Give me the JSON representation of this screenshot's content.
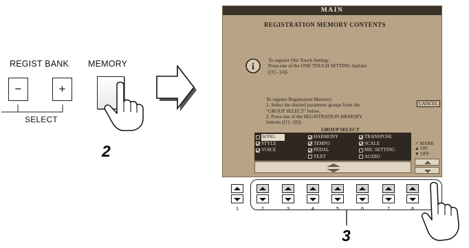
{
  "panel": {
    "regist_bank_label": "REGIST BANK",
    "memory_label": "MEMORY",
    "minus": "−",
    "plus": "+",
    "select_label": "SELECT",
    "step_memory": "2"
  },
  "screen": {
    "title": "MAIN",
    "heading": "REGISTRATION MEMORY CONTENTS",
    "info_icon": "i",
    "one_touch_lines": [
      "To register One Touch Setting:",
      "Press one of the ONE TOUCH SETTING buttons",
      "([1] - [4])."
    ],
    "regmem_lines": [
      "To register Registration Memory:",
      "1. Select the desired parameter groups from the",
      "    \"GROUP SELECT\" below.",
      "2. Press one of the REGISTRATION MEMORY",
      "    buttons ([1] - [8])."
    ],
    "cancel": "CANCEL",
    "group_select_label": "GROUP SELECT",
    "groups": {
      "col1": [
        {
          "label": "SONG",
          "checked": false
        },
        {
          "label": "STYLE",
          "checked": true
        },
        {
          "label": "VOICE",
          "checked": true
        }
      ],
      "col2": [
        {
          "label": "HARMONY",
          "checked": true
        },
        {
          "label": "TEMPO",
          "checked": true
        },
        {
          "label": "PEDAL",
          "checked": true
        },
        {
          "label": "TEXT",
          "checked": false
        }
      ],
      "col3": [
        {
          "label": "TRANSPOSE",
          "checked": true
        },
        {
          "label": "SCALE",
          "checked": true
        },
        {
          "label": "MIC SETTING",
          "checked": false
        },
        {
          "label": "AUDIO",
          "checked": false
        }
      ]
    },
    "mark_lines": [
      "✓ MARK",
      "▲ ON",
      "▼ OFF"
    ]
  },
  "hardware": {
    "numbers": [
      "1",
      "2",
      "3",
      "4",
      "5",
      "6",
      "7",
      "8"
    ],
    "step_buttons": "3"
  }
}
